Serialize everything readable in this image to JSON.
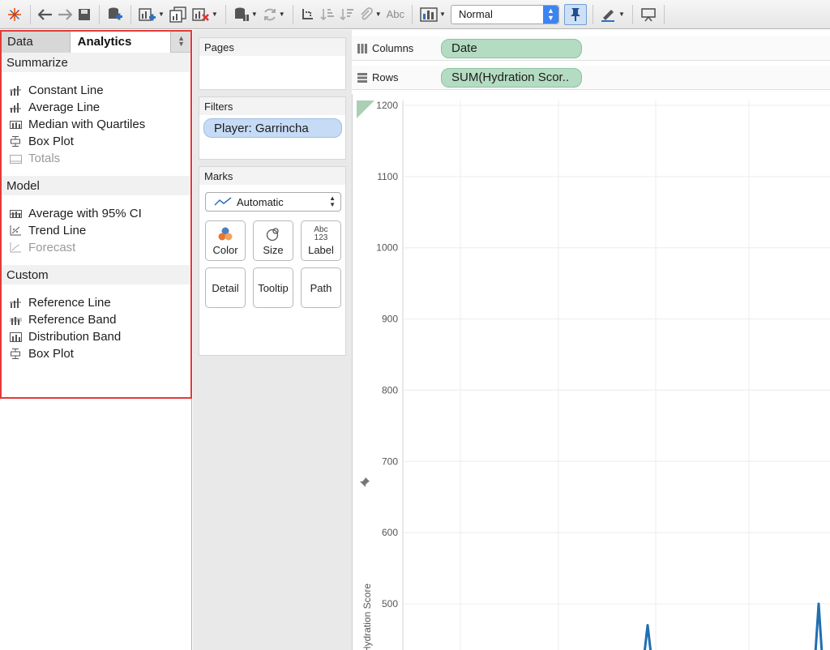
{
  "toolbar": {
    "icons": [
      "tableau-logo-icon",
      "undo-icon",
      "redo-icon",
      "save-icon",
      "new-datasource-icon",
      "new-worksheet-icon",
      "duplicate-sheet-icon",
      "clear-sheet-icon",
      "pause-updates-icon",
      "refresh-icon",
      "swap-icon",
      "sort-ascending-icon",
      "sort-descending-icon",
      "attach-icon",
      "label-icon",
      "show-me-icon",
      "pin-icon",
      "highlight-icon",
      "presentation-icon"
    ],
    "abc_label": "Abc",
    "fit_value": "Normal"
  },
  "left_panel": {
    "tab_data": "Data",
    "tab_analytics": "Analytics",
    "sections": [
      {
        "title": "Summarize",
        "items": [
          {
            "label": "Constant Line",
            "icon": "constant-line-icon",
            "disabled": false
          },
          {
            "label": "Average Line",
            "icon": "average-line-icon",
            "disabled": false
          },
          {
            "label": "Median with Quartiles",
            "icon": "median-quartiles-icon",
            "disabled": false
          },
          {
            "label": "Box Plot",
            "icon": "box-plot-icon",
            "disabled": false
          },
          {
            "label": "Totals",
            "icon": "totals-icon",
            "disabled": true
          }
        ]
      },
      {
        "title": "Model",
        "items": [
          {
            "label": "Average with 95% CI",
            "icon": "average-ci-icon",
            "disabled": false
          },
          {
            "label": "Trend Line",
            "icon": "trend-line-icon",
            "disabled": false
          },
          {
            "label": "Forecast",
            "icon": "forecast-icon",
            "disabled": true
          }
        ]
      },
      {
        "title": "Custom",
        "items": [
          {
            "label": "Reference Line",
            "icon": "reference-line-icon",
            "disabled": false
          },
          {
            "label": "Reference Band",
            "icon": "reference-band-icon",
            "disabled": false
          },
          {
            "label": "Distribution Band",
            "icon": "distribution-band-icon",
            "disabled": false
          },
          {
            "label": "Box Plot",
            "icon": "box-plot-icon",
            "disabled": false
          }
        ]
      }
    ]
  },
  "pages": {
    "title": "Pages"
  },
  "filters": {
    "title": "Filters",
    "pill": "Player: Garrincha"
  },
  "marks": {
    "title": "Marks",
    "type": "Automatic",
    "buttons": [
      "Color",
      "Size",
      "Label",
      "Detail",
      "Tooltip",
      "Path"
    ],
    "label_icon_top": "Abc",
    "label_icon_bottom": "123"
  },
  "shelves": {
    "columns_label": "Columns",
    "columns_pill": "Date",
    "rows_label": "Rows",
    "rows_pill": "SUM(Hydration Scor.."
  },
  "chart_data": {
    "type": "line",
    "title": "",
    "xlabel": "",
    "ylabel": "Hydration Score",
    "ylim": [
      450,
      1200
    ],
    "yticks": [
      500,
      600,
      700,
      800,
      900,
      1000,
      1100,
      1200
    ],
    "grid": true,
    "series": [
      {
        "name": "",
        "color": "#1f6fb2",
        "peaks": [
          470,
          500
        ]
      }
    ]
  }
}
